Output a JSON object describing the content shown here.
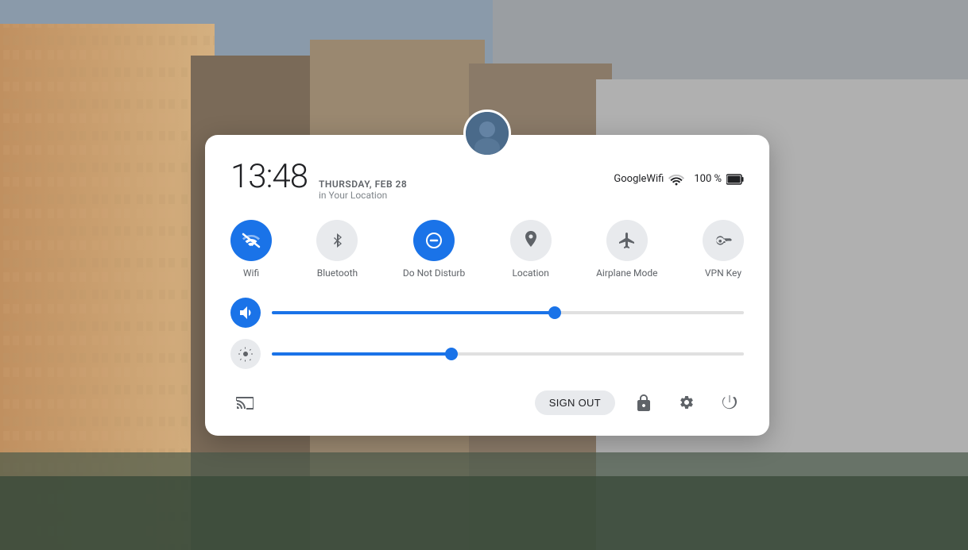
{
  "background": {
    "description": "City buildings urban street"
  },
  "panel": {
    "time": "13:48",
    "date": "THURSDAY, FEB 28",
    "location": "in Your Location",
    "wifi_name": "GoogleWifi",
    "battery_pct": "100 %",
    "avatar_label": "User avatar"
  },
  "toggles": [
    {
      "id": "wifi",
      "label": "Wifi",
      "active": true,
      "icon": "wifi"
    },
    {
      "id": "bluetooth",
      "label": "Bluetooth",
      "active": false,
      "icon": "bluetooth"
    },
    {
      "id": "do-not-disturb",
      "label": "Do Not Disturb",
      "active": true,
      "icon": "dnd"
    },
    {
      "id": "location",
      "label": "Location",
      "active": false,
      "icon": "location"
    },
    {
      "id": "airplane-mode",
      "label": "Airplane Mode",
      "active": false,
      "icon": "airplane"
    },
    {
      "id": "vpn-key",
      "label": "VPN Key",
      "active": false,
      "icon": "vpn"
    }
  ],
  "sliders": [
    {
      "id": "volume",
      "label": "Volume",
      "value": 60,
      "icon": "speaker",
      "active": true
    },
    {
      "id": "brightness",
      "label": "Brightness",
      "value": 38,
      "icon": "brightness",
      "active": false
    }
  ],
  "bottom": {
    "cast_label": "Cast",
    "sign_out_label": "SIGN OUT",
    "lock_label": "Lock screen",
    "settings_label": "Settings",
    "power_label": "Power"
  }
}
